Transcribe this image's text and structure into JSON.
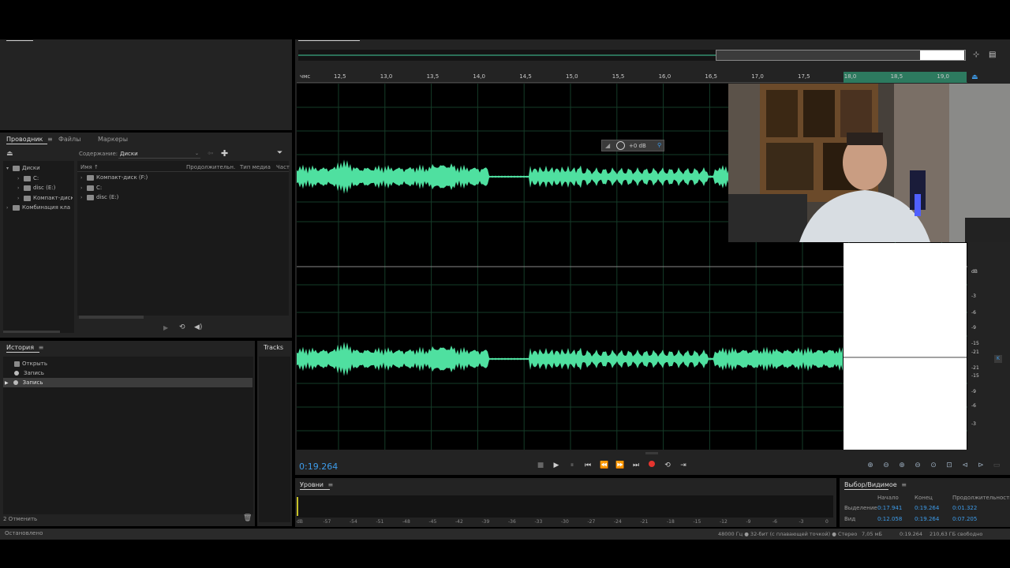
{
  "explorer": {
    "tabs": [
      "Проводник",
      "Файлы",
      "Маркеры"
    ],
    "content_label": "Содержание:",
    "content_value": "Диски",
    "tree": [
      {
        "label": "Диски"
      },
      {
        "label": "C:"
      },
      {
        "label": "disc (E:)"
      },
      {
        "label": "Компакт-диск"
      },
      {
        "label": "Комбинация кла"
      }
    ],
    "columns": [
      "Имя",
      "Продолжительн.",
      "Тип медиа",
      "Част"
    ],
    "files": [
      "Компакт-диск (F:)",
      "C:",
      "disc (E:)"
    ]
  },
  "history": {
    "title": "История",
    "items": [
      "Открыть",
      "Запись",
      "Запись"
    ],
    "undo_count": "2 Отменить",
    "tracks_label": "Tracks"
  },
  "status": {
    "left": "Остановлено",
    "format": "48000 Гц ● 32-бит (с плавающей точкой) ● Стерео",
    "size": "7,05 мБ",
    "duration": "0:19.264",
    "free": "210,63 ГБ свободно"
  },
  "ruler": {
    "unit": "чмс",
    "ticks": [
      "12,5",
      "13,0",
      "13,5",
      "14,0",
      "14,5",
      "15,0",
      "15,5",
      "16,0",
      "16,5",
      "17,0",
      "17,5",
      "18,0",
      "18,5",
      "19,0"
    ]
  },
  "hud": {
    "gain": "+0 dB"
  },
  "db_scale": {
    "unit": "dB",
    "top": [
      "-3",
      "-6",
      "-9",
      "-15",
      "-21"
    ],
    "bottom": [
      "-21",
      "-15",
      "-9",
      "-6",
      "-3"
    ]
  },
  "transport": {
    "time": "0:19.264"
  },
  "levels": {
    "title": "Уровни",
    "scale": [
      "dB",
      "-57",
      "-54",
      "-51",
      "-48",
      "-45",
      "-42",
      "-39",
      "-36",
      "-33",
      "-30",
      "-27",
      "-24",
      "-21",
      "-18",
      "-15",
      "-12",
      "-9",
      "-6",
      "-3",
      "0"
    ]
  },
  "selection": {
    "title": "Выбор/Видимое",
    "headers": [
      "Начало",
      "Конец",
      "Продолжительность"
    ],
    "rows": [
      {
        "label": "Выделение",
        "start": "0:17.941",
        "end": "0:19.264",
        "dur": "0:01.322"
      },
      {
        "label": "Вид",
        "start": "0:12.058",
        "end": "0:19.264",
        "dur": "0:07.205"
      }
    ]
  },
  "colors": {
    "waveform": "#4fe0a0",
    "accent": "#3d9be9",
    "record": "#e5352f"
  }
}
